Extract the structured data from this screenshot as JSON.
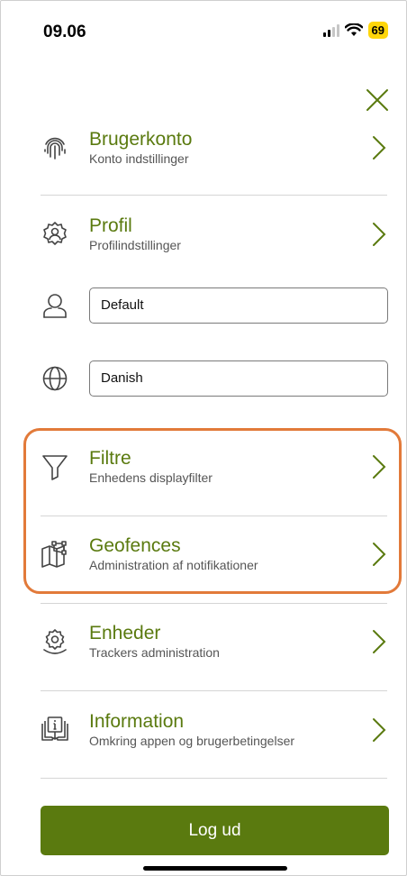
{
  "status_bar": {
    "time": "09.06",
    "battery": "69"
  },
  "menu": {
    "account": {
      "title": "Brugerkonto",
      "subtitle": "Konto indstillinger"
    },
    "profile": {
      "title": "Profil",
      "subtitle": "Profilindstillinger"
    },
    "profile_field": {
      "value": "Default"
    },
    "language_field": {
      "value": "Danish"
    },
    "filters": {
      "title": "Filtre",
      "subtitle": "Enhedens displayfilter"
    },
    "geofences": {
      "title": "Geofences",
      "subtitle": "Administration af notifikationer"
    },
    "devices": {
      "title": "Enheder",
      "subtitle": "Trackers administration"
    },
    "information": {
      "title": "Information",
      "subtitle": "Omkring appen og brugerbetingelser"
    }
  },
  "logout": {
    "label": "Log ud"
  },
  "colors": {
    "accent": "#5a7a0f",
    "highlight": "#e27a3a",
    "battery": "#ffd60a"
  }
}
